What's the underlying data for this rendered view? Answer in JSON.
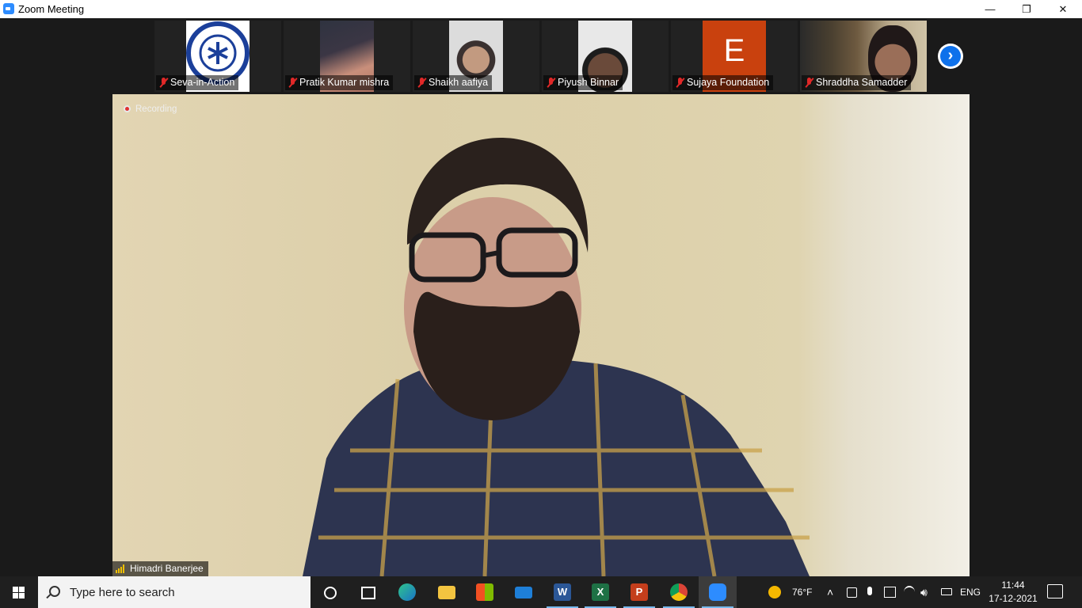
{
  "window": {
    "title": "Zoom Meeting",
    "minimize": "—",
    "restore": "❐",
    "close": "✕"
  },
  "gallery": {
    "participants": [
      {
        "name": "Seva-in-Action",
        "muted": true,
        "video": "logo"
      },
      {
        "name": "Pratik Kumar mishra",
        "muted": true,
        "video": "camera"
      },
      {
        "name": "Shaikh aafiya",
        "muted": true,
        "video": "camera"
      },
      {
        "name": "Piyush Binnar",
        "muted": true,
        "video": "camera"
      },
      {
        "name": "Sujaya Foundation",
        "muted": true,
        "video": "avatar",
        "avatar_letter": "E",
        "avatar_color": "#c9410e"
      },
      {
        "name": "Shraddha Samadder",
        "muted": true,
        "video": "camera"
      }
    ],
    "next_page_icon": "chevron-right-icon"
  },
  "main_video": {
    "recording_label": "Recording",
    "speaker_name": "Himadri Banerjee"
  },
  "taskbar": {
    "search_placeholder": "Type here to search",
    "apps": [
      "cortana-icon",
      "task-view-icon",
      "edge-icon",
      "file-explorer-icon",
      "microsoft-store-icon",
      "mail-icon",
      "word-icon",
      "excel-icon",
      "powerpoint-icon",
      "chrome-icon",
      "zoom-icon"
    ],
    "weather": "76°F",
    "language": "ENG",
    "time": "11:44",
    "date": "17-12-2021"
  },
  "colors": {
    "zoom_blue": "#0e71eb",
    "recording_red": "#e03030",
    "mute_red": "#e02828",
    "taskbar_bg": "#1f1f1f"
  }
}
